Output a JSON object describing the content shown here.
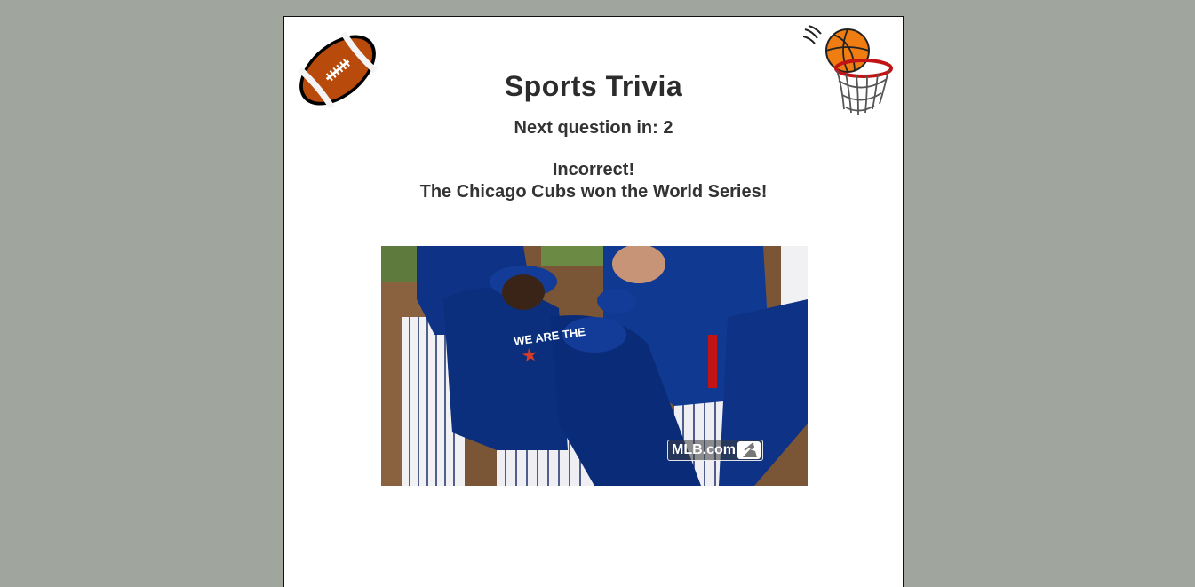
{
  "page": {
    "title": "Sports Trivia",
    "countdown": "Next question in: 2",
    "result_status": "Incorrect!",
    "result_answer": "The Chicago Cubs won the World Series!"
  },
  "media": {
    "watermark": "MLB.com",
    "jersey_text": "WE ARE THE"
  },
  "icons": {
    "left": "football-icon",
    "right": "basketball-hoop-icon"
  },
  "colors": {
    "background": "#a0a59e",
    "panel": "#ffffff",
    "text": "#333333",
    "football": "#b84a0c",
    "basketball": "#f07d12",
    "cubs_blue": "#0e3386"
  }
}
